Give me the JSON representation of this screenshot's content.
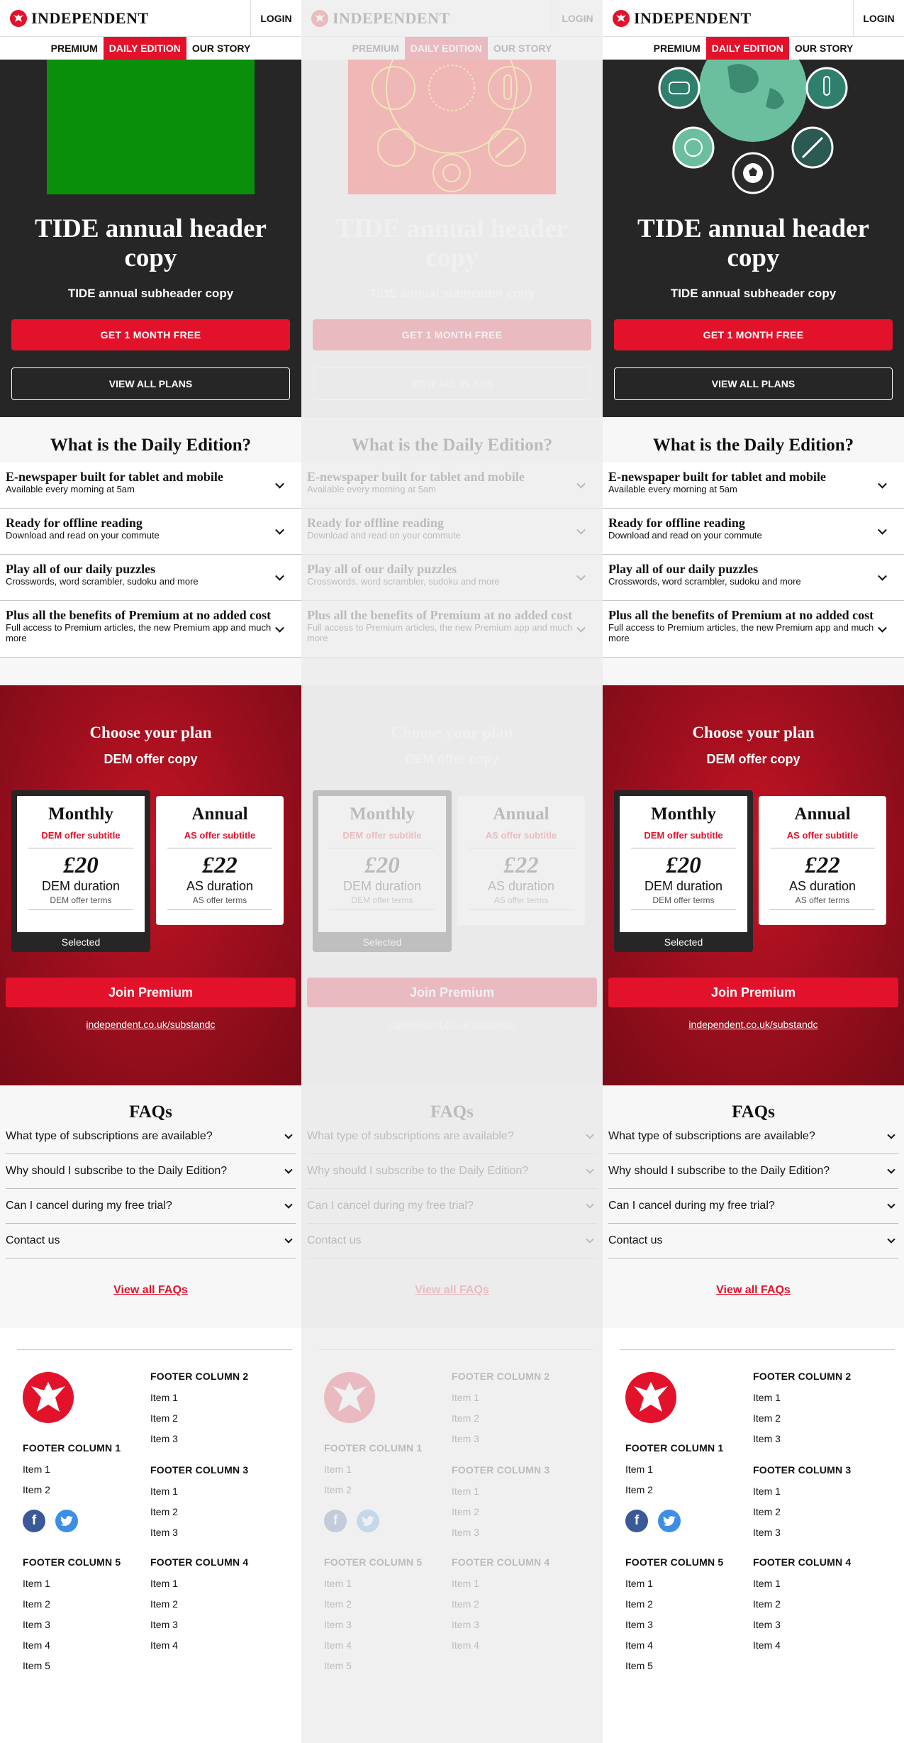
{
  "header": {
    "logo_text": "INDEPENDENT",
    "login_label": "LOGIN",
    "nav": [
      {
        "label": "PREMIUM",
        "active": false
      },
      {
        "label": "DAILY EDITION",
        "active": true
      },
      {
        "label": "OUR STORY",
        "active": false
      }
    ]
  },
  "hero": {
    "title": "TIDE annual header copy",
    "subtitle": "TIDE annual subheader copy",
    "cta_primary": "GET 1 MONTH FREE",
    "cta_secondary": "VIEW ALL PLANS",
    "image_colors": {
      "green": "#0a8f0a",
      "red": "#ff0000",
      "teal": "#2f7f6c"
    }
  },
  "daily_edition": {
    "title": "What is the Daily Edition?",
    "items": [
      {
        "heading": "E-newspaper built for tablet and mobile",
        "desc": "Available every morning at 5am"
      },
      {
        "heading": "Ready for offline reading",
        "desc": "Download and read on your commute"
      },
      {
        "heading": "Play all of our daily puzzles",
        "desc": "Crosswords, word scrambler, sudoku and more"
      },
      {
        "heading": "Plus all the benefits of Premium at no added cost",
        "desc": "Full access to Premium articles, the new Premium app and much more"
      }
    ]
  },
  "plans": {
    "title": "Choose your plan",
    "subtitle": "DEM offer copy",
    "monthly": {
      "name": "Monthly",
      "subtitle": "DEM offer subtitle",
      "price": "£20",
      "duration": "DEM duration",
      "terms": "DEM offer terms",
      "selected_label": "Selected"
    },
    "annual": {
      "name": "Annual",
      "subtitle": "AS offer subtitle",
      "price": "£22",
      "duration": "AS duration",
      "terms": "AS offer terms"
    },
    "join_label": "Join Premium",
    "link": "independent.co.uk/substandc"
  },
  "faqs": {
    "title": "FAQs",
    "items": [
      "What type of subscriptions are available?",
      "Why should I subscribe to the Daily Edition?",
      "Can I cancel during my free trial?",
      "Contact us"
    ],
    "view_all": "View all FAQs"
  },
  "footer": {
    "col1": {
      "title": "FOOTER COLUMN 1",
      "items": [
        "Item 1",
        "Item 2"
      ]
    },
    "col2": {
      "title": "FOOTER COLUMN 2",
      "items": [
        "Item 1",
        "Item 2",
        "Item 3"
      ]
    },
    "col3": {
      "title": "FOOTER COLUMN 3",
      "items": [
        "Item 1",
        "Item 2",
        "Item 3"
      ]
    },
    "col4": {
      "title": "FOOTER COLUMN 4",
      "items": [
        "Item 1",
        "Item 2",
        "Item 3",
        "Item 4"
      ]
    },
    "col5": {
      "title": "FOOTER COLUMN 5",
      "items": [
        "Item 1",
        "Item 2",
        "Item 3",
        "Item 4",
        "Item 5"
      ]
    },
    "social": [
      "facebook-icon",
      "twitter-icon"
    ]
  },
  "colors": {
    "brand_red": "#e3122b",
    "dark": "#262626",
    "plans_red": "#a00f1e",
    "facebook": "#3b5998",
    "twitter": "#1da1f2"
  }
}
